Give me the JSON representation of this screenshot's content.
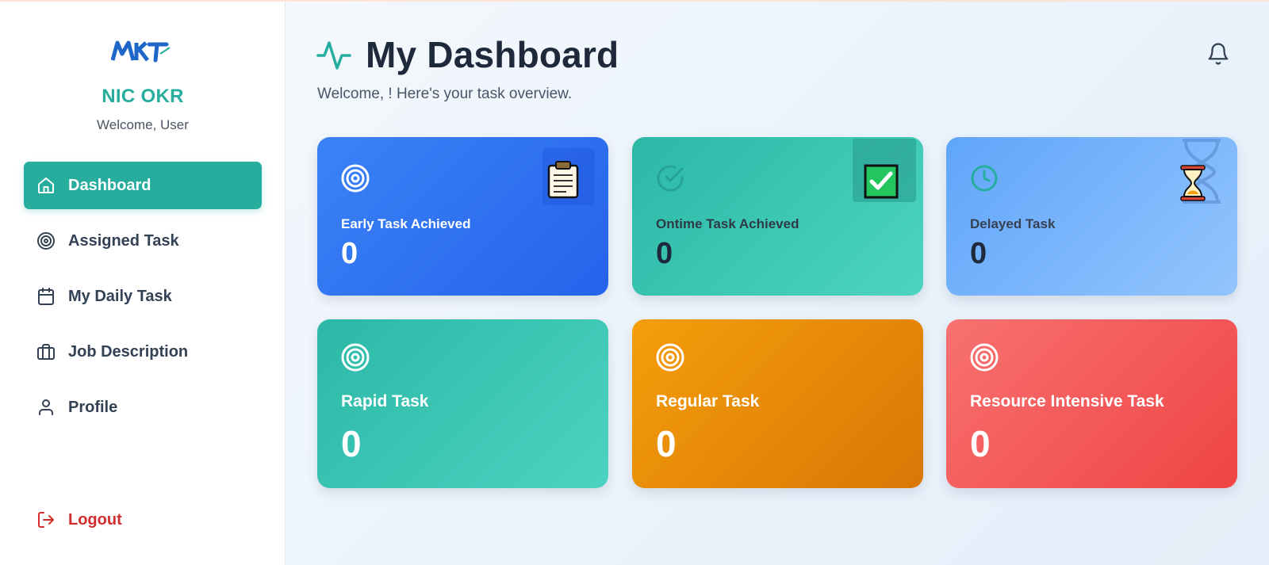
{
  "sidebar": {
    "logo_text": "MKT",
    "app_title": "NIC OKR",
    "welcome": "Welcome, User",
    "items": [
      {
        "label": "Dashboard",
        "icon": "home-icon",
        "active": true
      },
      {
        "label": "Assigned Task",
        "icon": "target-icon"
      },
      {
        "label": "My Daily Task",
        "icon": "calendar-icon"
      },
      {
        "label": "Job Description",
        "icon": "briefcase-icon"
      },
      {
        "label": "Profile",
        "icon": "user-icon"
      }
    ],
    "logout": {
      "label": "Logout",
      "icon": "logout-icon"
    }
  },
  "header": {
    "title": "My Dashboard",
    "icon": "activity-icon",
    "subtitle": "Welcome, ! Here's your task overview.",
    "bell_icon": "bell-icon"
  },
  "cards": [
    {
      "label": "Early Task Achieved",
      "value": "0",
      "icon": "target-icon",
      "badge": "clipboard-icon",
      "color": "#2563eb"
    },
    {
      "label": "Ontime Task Achieved",
      "value": "0",
      "icon": "check-circle-icon",
      "badge": "check-box-icon",
      "color": "#2bb8a7"
    },
    {
      "label": "Delayed Task",
      "value": "0",
      "icon": "clock-icon",
      "badge": "hourglass-icon",
      "color": "#60a5fa"
    },
    {
      "label": "Rapid Task",
      "value": "0",
      "icon": "target-icon",
      "color": "#2bb8a7"
    },
    {
      "label": "Regular Task",
      "value": "0",
      "icon": "target-icon",
      "color": "#f59e0b"
    },
    {
      "label": "Resource Intensive Task",
      "value": "0",
      "icon": "target-icon",
      "color": "#ef4444"
    }
  ],
  "colors": {
    "accent": "#26ad9e",
    "logout": "#d22d2d",
    "logo": "#1e66c7"
  }
}
